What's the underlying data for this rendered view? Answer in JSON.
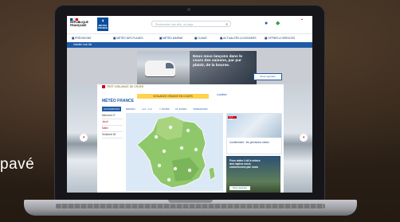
{
  "tagline": "pavé",
  "header": {
    "republic_logo_text": "RÉPUBLIQUE FRANÇAISE",
    "brand_text": "MÉTÉO FRANCE",
    "search_placeholder": "Rechercher une ville, un pays"
  },
  "nav": {
    "items": [
      {
        "label": "PRÉVISIONS"
      },
      {
        "label": "MÉTÉO DES PLAGES"
      },
      {
        "label": "MÉTÉO MARINE"
      },
      {
        "label": "CLIMAT"
      },
      {
        "label": "ACTUALITÉS & DOSSIERS"
      },
      {
        "label": "OFFRES & SERVICES"
      }
    ]
  },
  "subbar_text": "Installer mon tile",
  "ad": {
    "text": "Nous nous lançons dans le cours des saisons, par pur plaisir, de la bourse.",
    "button": "Nous rejoindre"
  },
  "panel": {
    "vigilance_label": "TEST VIGILANCE DE CRUES",
    "banner": "VIGILANCE ORANGE EN COURS",
    "title": "MÉTÉO FRANCE",
    "locate": "Localiser",
    "tabs": [
      {
        "label": "AUJOURD'HUI",
        "active": true
      },
      {
        "label": "DEMAIN",
        "active": false
      },
      {
        "label": "J+2 - J+3",
        "active": false
      },
      {
        "label": "7 JOURS",
        "active": false
      },
      {
        "label": "15 JOURS",
        "active": false
      },
      {
        "label": "TENDANCES",
        "active": false
      }
    ],
    "days": [
      {
        "label": "Mercredi 17",
        "red": false
      },
      {
        "label": "Jeudi",
        "red": true
      },
      {
        "label": "Matin",
        "red": true
      },
      {
        "label": "Vendredi 18",
        "red": false
      }
    ],
    "card1_tag": "À LA UNE",
    "card1_text": "Confinement : les prévisions météo",
    "card2": {
      "text": "Pour aider Lidl à mieux dos lapins nous cmmencons par vous",
      "button": "Nous rejoindre"
    }
  },
  "colors": {
    "brand_blue": "#1f5aa6",
    "alert_red": "#d0021b",
    "vigilance_yellow": "#ffd34d"
  }
}
